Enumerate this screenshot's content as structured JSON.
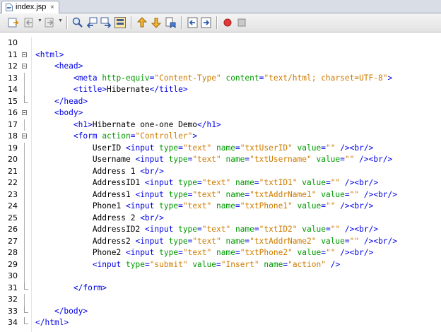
{
  "tab": {
    "label": "index.jsp",
    "close": "×"
  },
  "toolbar": {
    "buttons": [
      "last-edit-icon",
      "back-icon",
      "forward-icon",
      "find-icon",
      "find-previous-icon",
      "find-next-icon",
      "toggle-highlight-icon",
      "previous-bookmark-icon",
      "next-bookmark-icon",
      "toggle-bookmark-icon",
      "shift-left-icon",
      "shift-right-icon",
      "start-macro-icon",
      "stop-macro-icon"
    ]
  },
  "editor": {
    "lines": [
      {
        "n": "10",
        "tokens": []
      },
      {
        "n": "11",
        "tokens": [
          {
            "t": "tag",
            "v": "<html>"
          }
        ]
      },
      {
        "n": "12",
        "tokens": [
          {
            "t": "txt",
            "v": "    "
          },
          {
            "t": "tag",
            "v": "<head>"
          }
        ]
      },
      {
        "n": "13",
        "tokens": [
          {
            "t": "txt",
            "v": "        "
          },
          {
            "t": "tag",
            "v": "<meta "
          },
          {
            "t": "attr",
            "v": "http-equiv"
          },
          {
            "t": "tag",
            "v": "="
          },
          {
            "t": "val",
            "v": "\"Content-Type\""
          },
          {
            "t": "attr",
            "v": " content"
          },
          {
            "t": "tag",
            "v": "="
          },
          {
            "t": "val",
            "v": "\"text/html; charset=UTF-8\""
          },
          {
            "t": "tag",
            "v": ">"
          }
        ]
      },
      {
        "n": "14",
        "tokens": [
          {
            "t": "txt",
            "v": "        "
          },
          {
            "t": "tag",
            "v": "<title>"
          },
          {
            "t": "txt",
            "v": "Hibernate"
          },
          {
            "t": "tag",
            "v": "</title>"
          }
        ]
      },
      {
        "n": "15",
        "tokens": [
          {
            "t": "txt",
            "v": "    "
          },
          {
            "t": "tag",
            "v": "</head>"
          }
        ]
      },
      {
        "n": "16",
        "tokens": [
          {
            "t": "txt",
            "v": "    "
          },
          {
            "t": "tag",
            "v": "<body>"
          }
        ]
      },
      {
        "n": "17",
        "tokens": [
          {
            "t": "txt",
            "v": "        "
          },
          {
            "t": "tag",
            "v": "<h1>"
          },
          {
            "t": "txt",
            "v": "Hibernate one-one Demo"
          },
          {
            "t": "tag",
            "v": "</h1>"
          }
        ]
      },
      {
        "n": "18",
        "tokens": [
          {
            "t": "txt",
            "v": "        "
          },
          {
            "t": "tag",
            "v": "<form "
          },
          {
            "t": "attr",
            "v": "action"
          },
          {
            "t": "tag",
            "v": "="
          },
          {
            "t": "val",
            "v": "\"Controller\""
          },
          {
            "t": "tag",
            "v": ">"
          }
        ]
      },
      {
        "n": "19",
        "tokens": [
          {
            "t": "txt",
            "v": "            UserID "
          },
          {
            "t": "tag",
            "v": "<input "
          },
          {
            "t": "attr",
            "v": "type"
          },
          {
            "t": "tag",
            "v": "="
          },
          {
            "t": "val",
            "v": "\"text\""
          },
          {
            "t": "attr",
            "v": " name"
          },
          {
            "t": "tag",
            "v": "="
          },
          {
            "t": "val",
            "v": "\"txtUserID\""
          },
          {
            "t": "attr",
            "v": " value"
          },
          {
            "t": "tag",
            "v": "="
          },
          {
            "t": "val",
            "v": "\"\""
          },
          {
            "t": "tag",
            "v": " /><br/>"
          }
        ]
      },
      {
        "n": "20",
        "tokens": [
          {
            "t": "txt",
            "v": "            Username "
          },
          {
            "t": "tag",
            "v": "<input "
          },
          {
            "t": "attr",
            "v": "type"
          },
          {
            "t": "tag",
            "v": "="
          },
          {
            "t": "val",
            "v": "\"text\""
          },
          {
            "t": "attr",
            "v": " name"
          },
          {
            "t": "tag",
            "v": "="
          },
          {
            "t": "val",
            "v": "\"txtUsername\""
          },
          {
            "t": "attr",
            "v": " value"
          },
          {
            "t": "tag",
            "v": "="
          },
          {
            "t": "val",
            "v": "\"\""
          },
          {
            "t": "tag",
            "v": " /><br/>"
          }
        ]
      },
      {
        "n": "21",
        "tokens": [
          {
            "t": "txt",
            "v": "            Address 1 "
          },
          {
            "t": "tag",
            "v": "<br/>"
          }
        ]
      },
      {
        "n": "22",
        "tokens": [
          {
            "t": "txt",
            "v": "            AddressID1 "
          },
          {
            "t": "tag",
            "v": "<input "
          },
          {
            "t": "attr",
            "v": "type"
          },
          {
            "t": "tag",
            "v": "="
          },
          {
            "t": "val",
            "v": "\"text\""
          },
          {
            "t": "attr",
            "v": " name"
          },
          {
            "t": "tag",
            "v": "="
          },
          {
            "t": "val",
            "v": "\"txtID1\""
          },
          {
            "t": "attr",
            "v": " value"
          },
          {
            "t": "tag",
            "v": "="
          },
          {
            "t": "val",
            "v": "\"\""
          },
          {
            "t": "tag",
            "v": " /><br/>"
          }
        ]
      },
      {
        "n": "23",
        "tokens": [
          {
            "t": "txt",
            "v": "            Address1 "
          },
          {
            "t": "tag",
            "v": "<input "
          },
          {
            "t": "attr",
            "v": "type"
          },
          {
            "t": "tag",
            "v": "="
          },
          {
            "t": "val",
            "v": "\"text\""
          },
          {
            "t": "attr",
            "v": " name"
          },
          {
            "t": "tag",
            "v": "="
          },
          {
            "t": "val",
            "v": "\"txtAddrName1\""
          },
          {
            "t": "attr",
            "v": " value"
          },
          {
            "t": "tag",
            "v": "="
          },
          {
            "t": "val",
            "v": "\"\""
          },
          {
            "t": "tag",
            "v": " /><br/>"
          }
        ]
      },
      {
        "n": "24",
        "tokens": [
          {
            "t": "txt",
            "v": "            Phone1 "
          },
          {
            "t": "tag",
            "v": "<input "
          },
          {
            "t": "attr",
            "v": "type"
          },
          {
            "t": "tag",
            "v": "="
          },
          {
            "t": "val",
            "v": "\"text\""
          },
          {
            "t": "attr",
            "v": " name"
          },
          {
            "t": "tag",
            "v": "="
          },
          {
            "t": "val",
            "v": "\"txtPhone1\""
          },
          {
            "t": "attr",
            "v": " value"
          },
          {
            "t": "tag",
            "v": "="
          },
          {
            "t": "val",
            "v": "\"\""
          },
          {
            "t": "tag",
            "v": " /><br/>"
          }
        ]
      },
      {
        "n": "25",
        "tokens": [
          {
            "t": "txt",
            "v": "            Address 2 "
          },
          {
            "t": "tag",
            "v": "<br/>"
          }
        ]
      },
      {
        "n": "26",
        "tokens": [
          {
            "t": "txt",
            "v": "            AddressID2 "
          },
          {
            "t": "tag",
            "v": "<input "
          },
          {
            "t": "attr",
            "v": "type"
          },
          {
            "t": "tag",
            "v": "="
          },
          {
            "t": "val",
            "v": "\"text\""
          },
          {
            "t": "attr",
            "v": " name"
          },
          {
            "t": "tag",
            "v": "="
          },
          {
            "t": "val",
            "v": "\"txtID2\""
          },
          {
            "t": "attr",
            "v": " value"
          },
          {
            "t": "tag",
            "v": "="
          },
          {
            "t": "val",
            "v": "\"\""
          },
          {
            "t": "tag",
            "v": " /><br/>"
          }
        ]
      },
      {
        "n": "27",
        "tokens": [
          {
            "t": "txt",
            "v": "            Address2 "
          },
          {
            "t": "tag",
            "v": "<input "
          },
          {
            "t": "attr",
            "v": "type"
          },
          {
            "t": "tag",
            "v": "="
          },
          {
            "t": "val",
            "v": "\"text\""
          },
          {
            "t": "attr",
            "v": " name"
          },
          {
            "t": "tag",
            "v": "="
          },
          {
            "t": "val",
            "v": "\"txtAddrName2\""
          },
          {
            "t": "attr",
            "v": " value"
          },
          {
            "t": "tag",
            "v": "="
          },
          {
            "t": "val",
            "v": "\"\""
          },
          {
            "t": "tag",
            "v": " /><br/>"
          }
        ]
      },
      {
        "n": "28",
        "tokens": [
          {
            "t": "txt",
            "v": "            Phone2 "
          },
          {
            "t": "tag",
            "v": "<input "
          },
          {
            "t": "attr",
            "v": "type"
          },
          {
            "t": "tag",
            "v": "="
          },
          {
            "t": "val",
            "v": "\"text\""
          },
          {
            "t": "attr",
            "v": " name"
          },
          {
            "t": "tag",
            "v": "="
          },
          {
            "t": "val",
            "v": "\"txtPhone2\""
          },
          {
            "t": "attr",
            "v": " value"
          },
          {
            "t": "tag",
            "v": "="
          },
          {
            "t": "val",
            "v": "\"\""
          },
          {
            "t": "tag",
            "v": " /><br/>"
          }
        ]
      },
      {
        "n": "29",
        "tokens": [
          {
            "t": "txt",
            "v": "            "
          },
          {
            "t": "tag",
            "v": "<input "
          },
          {
            "t": "attr",
            "v": "type"
          },
          {
            "t": "tag",
            "v": "="
          },
          {
            "t": "val",
            "v": "\"submit\""
          },
          {
            "t": "attr",
            "v": " value"
          },
          {
            "t": "tag",
            "v": "="
          },
          {
            "t": "val",
            "v": "\"Insert\""
          },
          {
            "t": "attr",
            "v": " name"
          },
          {
            "t": "tag",
            "v": "="
          },
          {
            "t": "val",
            "v": "\"action\""
          },
          {
            "t": "tag",
            "v": " />"
          }
        ]
      },
      {
        "n": "30",
        "tokens": []
      },
      {
        "n": "31",
        "tokens": [
          {
            "t": "txt",
            "v": "        "
          },
          {
            "t": "tag",
            "v": "</form>"
          }
        ]
      },
      {
        "n": "32",
        "tokens": []
      },
      {
        "n": "33",
        "tokens": [
          {
            "t": "txt",
            "v": "    "
          },
          {
            "t": "tag",
            "v": "</body>"
          }
        ]
      },
      {
        "n": "34",
        "tokens": [
          {
            "t": "tag",
            "v": "</html>"
          }
        ]
      }
    ]
  }
}
